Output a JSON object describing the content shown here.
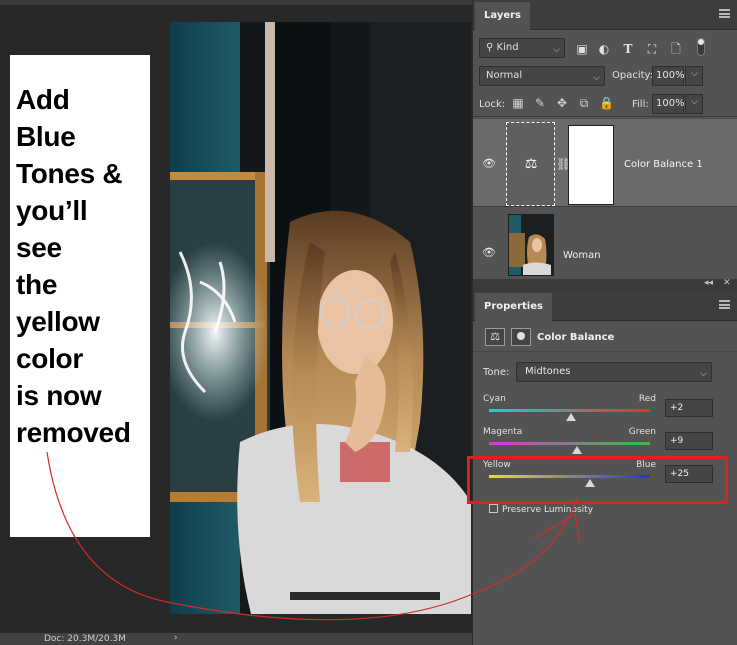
{
  "note": {
    "text": "Add\nBlue\nTones &\nyou’ll\nsee\nthe\nyellow\ncolor\nis now\nremoved"
  },
  "status_bar": {
    "doc": "Doc: 20.3M/20.3M",
    "arrow": "›"
  },
  "layers_panel": {
    "tab": "Layers",
    "menu_icon": "panel-menu-icon",
    "kind_filter": {
      "value": "Kind",
      "icon": "search-icon"
    },
    "filter_icons": [
      "image-icon",
      "adjustment-icon",
      "type-icon",
      "shape-icon",
      "smart-object-icon"
    ],
    "blend_mode": "Normal",
    "opacity_label": "Opacity:",
    "opacity_value": "100%",
    "lock_label": "Lock:",
    "lock_icons": [
      "lock-transparent-icon",
      "lock-pixels-icon",
      "lock-position-icon",
      "lock-artboard-icon",
      "lock-all-icon"
    ],
    "fill_label": "Fill:",
    "fill_value": "100%",
    "layers": [
      {
        "name": "Color Balance 1",
        "visible": true,
        "selected": true
      },
      {
        "name": "Woman",
        "visible": true,
        "selected": false
      }
    ]
  },
  "properties_panel": {
    "tab": "Properties",
    "title": "Color Balance",
    "tone_label": "Tone:",
    "tone_value": "Midtones",
    "sliders": [
      {
        "left": "Cyan",
        "right": "Red",
        "value": "+2",
        "level": 2,
        "colors": [
          "#19d6c8",
          "#e23030"
        ]
      },
      {
        "left": "Magenta",
        "right": "Green",
        "value": "+9",
        "level": 9,
        "colors": [
          "#d63ad6",
          "#36c036"
        ]
      },
      {
        "left": "Yellow",
        "right": "Blue",
        "value": "+25",
        "level": 25,
        "colors": [
          "#e8e020",
          "#2a30e0"
        ]
      }
    ],
    "preserve_luminosity": {
      "label": "Preserve Luminosity",
      "checked": false
    }
  },
  "colors": {
    "highlight": "#e02020",
    "panel_bg": "#535353",
    "canvas_bg": "#282828"
  }
}
